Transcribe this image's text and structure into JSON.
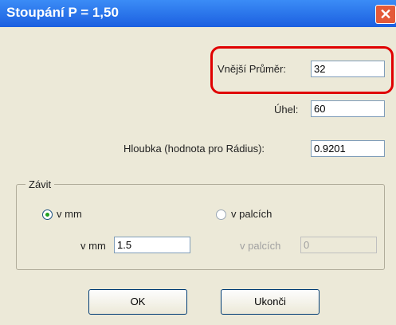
{
  "window": {
    "title": "Stoupání P = 1,50",
    "close_glyph": "✕"
  },
  "fields": {
    "outer_diameter": {
      "label": "Vnější Průměr:",
      "value": "32"
    },
    "angle": {
      "label": "Úhel:",
      "value": "60"
    },
    "depth": {
      "label": "Hloubka (hodnota pro Rádius):",
      "value": "0.9201"
    }
  },
  "thread_group": {
    "title": "Závit",
    "option_mm": {
      "label": "v mm",
      "selected": true
    },
    "option_inch": {
      "label": "v palcích",
      "selected": false
    },
    "mm_field": {
      "label": "v mm",
      "value": "1.5"
    },
    "inch_field": {
      "label": "v palcích",
      "value": "0"
    }
  },
  "buttons": {
    "ok": "OK",
    "exit": "Ukonči"
  },
  "colors": {
    "title_bar": "#1b5fe0",
    "highlight": "#e00000",
    "background": "#ece9d8"
  }
}
